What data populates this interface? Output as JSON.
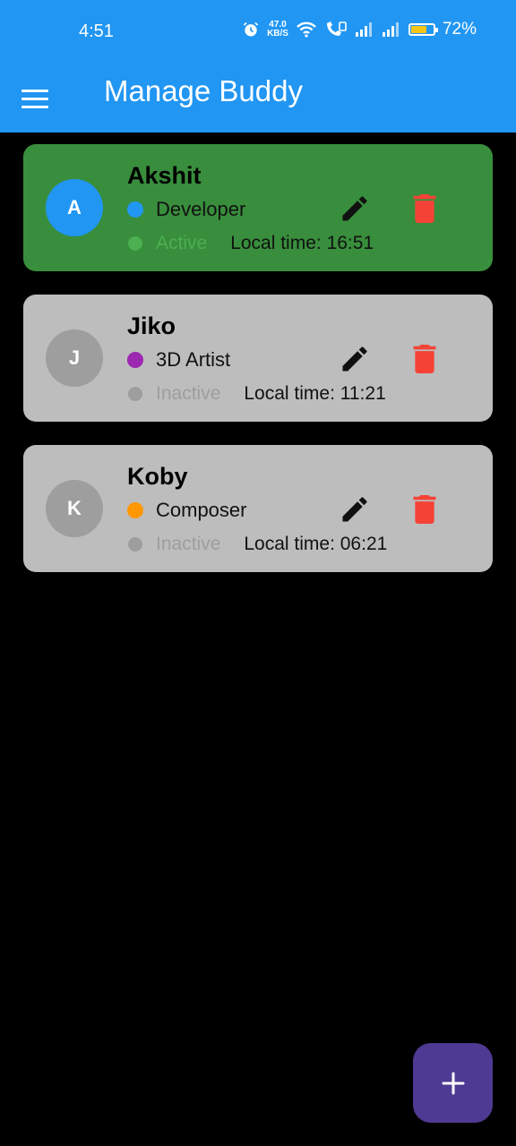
{
  "status_bar": {
    "time": "4:51",
    "net_speed_value": "47.0",
    "net_speed_unit": "KB/S",
    "battery_percent": "72%",
    "battery_level": 0.72
  },
  "app_bar": {
    "title": "Manage Buddy",
    "color": "#2196F3",
    "menu_icon": "menu-icon"
  },
  "buddies": [
    {
      "initial": "A",
      "name": "Akshit",
      "role": "Developer",
      "role_color": "#2196F3",
      "status": "Active",
      "status_color": "#4CAF50",
      "local_time": "Local time: 16:51",
      "card_color": "#388E3C",
      "avatar_color": "#2196F3"
    },
    {
      "initial": "J",
      "name": "Jiko",
      "role": "3D Artist",
      "role_color": "#9C27B0",
      "status": "Inactive",
      "status_color": "#9E9E9E",
      "local_time": "Local time: 11:21",
      "card_color": "#BDBDBD",
      "avatar_color": "#9E9E9E"
    },
    {
      "initial": "K",
      "name": "Koby",
      "role": "Composer",
      "role_color": "#FF9800",
      "status": "Inactive",
      "status_color": "#9E9E9E",
      "local_time": "Local time: 06:21",
      "card_color": "#BDBDBD",
      "avatar_color": "#9E9E9E"
    }
  ],
  "fab": {
    "icon": "plus-icon",
    "color": "#4E3A92"
  },
  "colors": {
    "edit_icon": "#111111",
    "delete_icon": "#F44336",
    "background": "#000000"
  }
}
